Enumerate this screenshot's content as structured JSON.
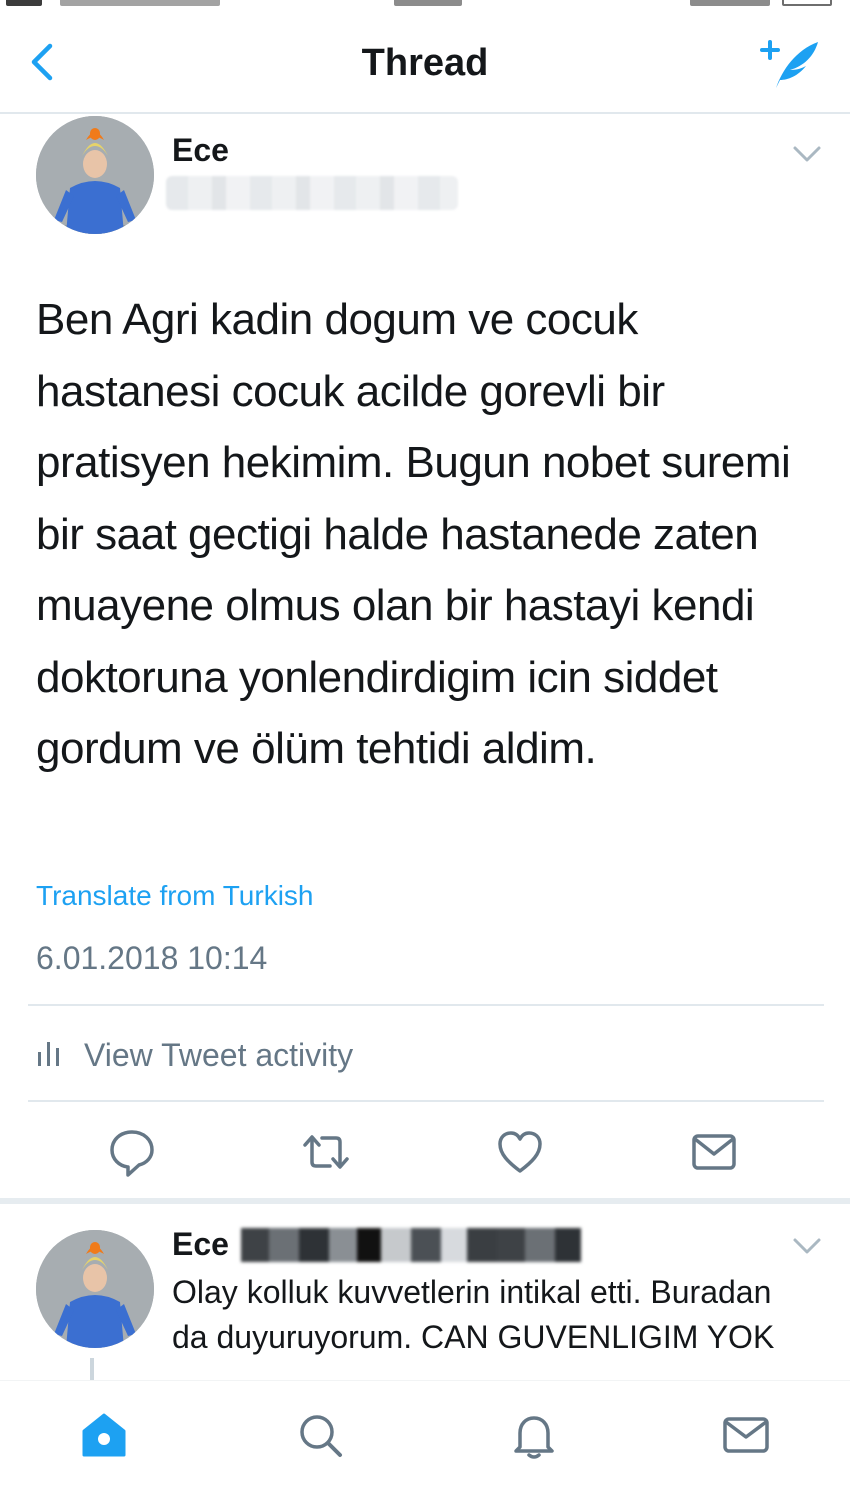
{
  "navbar": {
    "title": "Thread"
  },
  "tweet": {
    "author_name": "Ece",
    "text": "Ben Agri kadin dogum ve cocuk hastanesi cocuk acilde gorevli bir pratisyen hekimim. Bugun nobet suremi bir saat gectigi halde hastanede zaten muayene olmus olan bir hastayi kendi doktoruna yonlendirdigim icin siddet gordum ve ölüm tehtidi aldim.",
    "translate_label": "Translate from Turkish",
    "timestamp": "6.01.2018 10:14",
    "activity_label": "View Tweet activity"
  },
  "reply": {
    "author_name": "Ece",
    "text": "Olay kolluk kuvvetlerin intikal etti. Buradan da duyuruyorum. CAN GUVENLIGIM YOK"
  },
  "icons": {
    "back": "chevron-left-icon",
    "compose": "compose-tweet-icon",
    "reply": "reply-bubble-icon",
    "retweet": "retweet-icon",
    "like": "heart-icon",
    "dm": "envelope-icon",
    "home": "home-icon",
    "search": "search-icon",
    "notifications": "bell-icon",
    "messages": "envelope-icon"
  },
  "colors": {
    "accent": "#1da1f2",
    "text": "#14171a",
    "secondary": "#657786",
    "divider": "#e1e8ed"
  }
}
